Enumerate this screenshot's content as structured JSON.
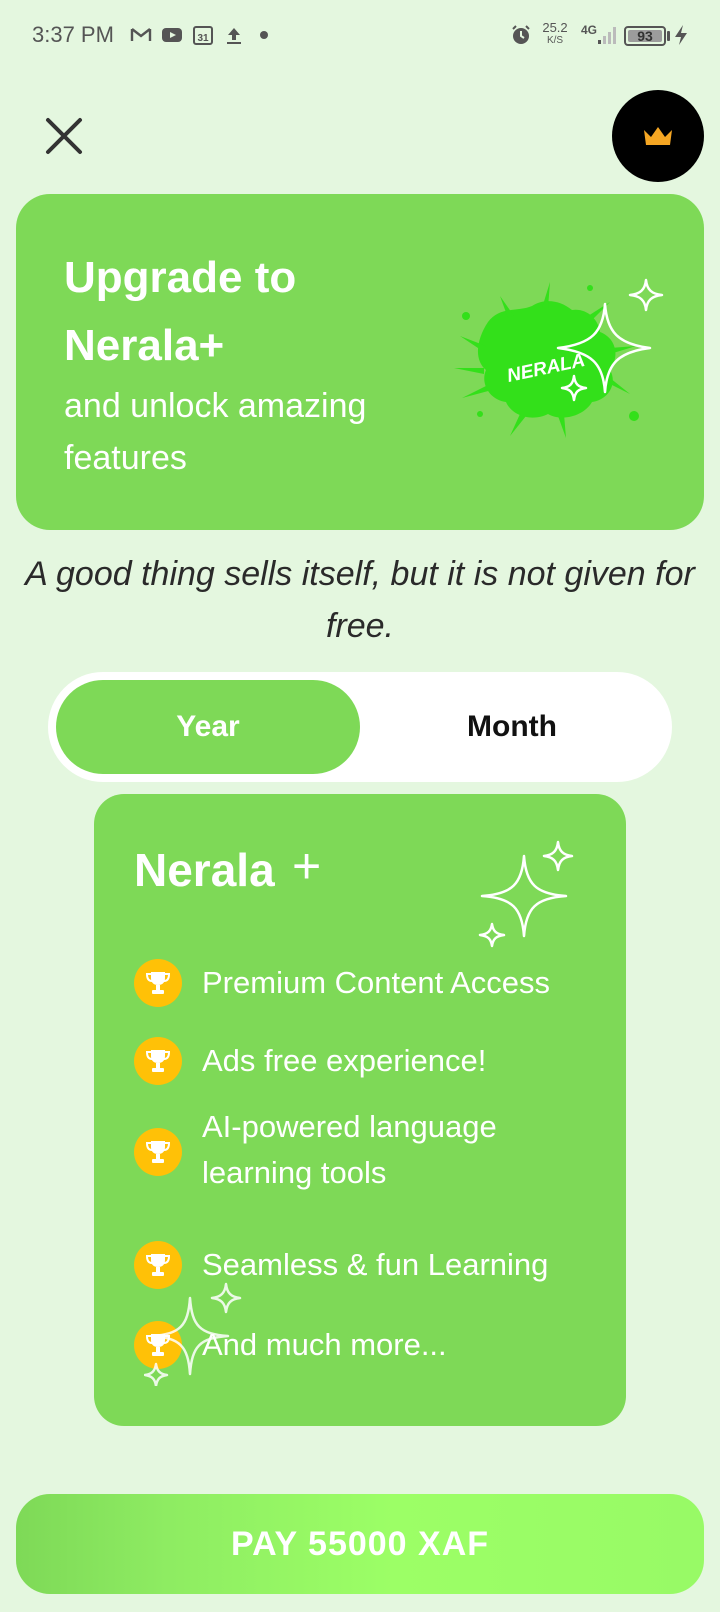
{
  "status_bar": {
    "time": "3:37 PM",
    "net_speed": "25.2",
    "net_unit": "K/S",
    "network": "4G",
    "battery": "93",
    "icons": [
      "gmail-icon",
      "youtube-icon",
      "calendar-icon",
      "upload-icon",
      "dot-icon",
      "alarm-icon",
      "signal-icon",
      "charging-icon"
    ]
  },
  "header": {
    "close_icon": "close-icon",
    "premium_icon": "crown-icon"
  },
  "hero": {
    "title": "Upgrade to Nerala+",
    "subtitle": "and unlock amazing features",
    "logo_text": "NERALA"
  },
  "tagline": "A good thing sells itself, but it is not given for free.",
  "billing_toggle": {
    "options": [
      "Year",
      "Month"
    ],
    "selected": "Year"
  },
  "plan": {
    "name": "Nerala",
    "plus": "+",
    "features": [
      "Premium Content Access",
      "Ads free experience!",
      "AI-powered language learning tools",
      "Seamless & fun Learning",
      "And much more..."
    ]
  },
  "pay_button": {
    "label": "PAY 55000 XAF"
  },
  "colors": {
    "background": "#E4F7DF",
    "primary_green": "#7ED957",
    "accent_green": "#9CFF66",
    "trophy": "#FFC107",
    "crown": "#F5A623"
  }
}
